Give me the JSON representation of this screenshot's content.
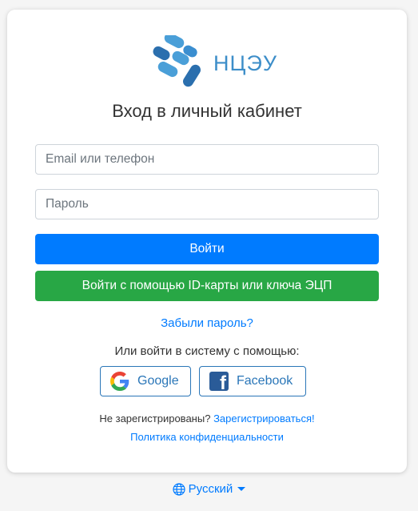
{
  "logo": {
    "text": "НЦЭУ",
    "icon": "ncey-logo-icon"
  },
  "title": "Вход в личный кабинет",
  "form": {
    "login_placeholder": "Email или телефон",
    "password_placeholder": "Пароль",
    "login_button": "Войти",
    "id_card_button": "Войти с помощью ID-карты или ключа ЭЦП",
    "forgot_password": "Забыли пароль?"
  },
  "social": {
    "prompt": "Или войти в систему с помощью:",
    "google_label": "Google",
    "google_icon": "google-icon",
    "facebook_label": "Facebook",
    "facebook_icon": "facebook-icon"
  },
  "register": {
    "question": "Не зарегистрированы?",
    "link": "Зарегистрироваться!"
  },
  "privacy_link": "Политика конфиденциальности",
  "language": {
    "label": "Русский",
    "icon": "globe-icon"
  },
  "colors": {
    "primary": "#007bff",
    "success": "#28a745",
    "social_border": "#2a76b8",
    "logo_blue": "#3d8ec9",
    "facebook_blue": "#2a5b98"
  }
}
